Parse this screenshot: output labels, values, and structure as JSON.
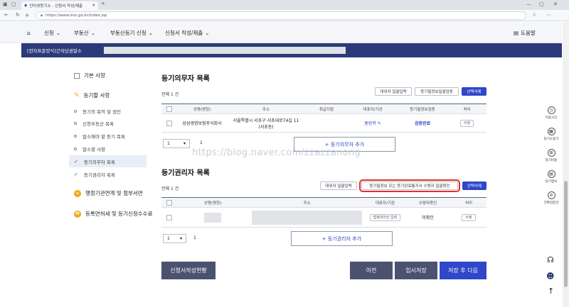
{
  "browser": {
    "tab_title": "인터넷등기소 - 신청서 작성/제출",
    "new_tab": "+",
    "url": "https://www.iros.go.kr/index.jsp"
  },
  "nav": {
    "home_icon": "home-icon",
    "items": [
      "신청",
      "부동산",
      "부동산등기 신청",
      "신청서 작성/제출"
    ],
    "help": "도움말"
  },
  "banner": {
    "label": "[전자표준양식]근저당권말소"
  },
  "left_menu": {
    "basic": "기본 사항",
    "items_title": "등기할 사항",
    "sub": [
      "등기의 목적 및 원인",
      "신청부동산 목록",
      "말소해야 할 등기 목록",
      "말소할 사항",
      "등기의무자 목록",
      "등기권리자 목록"
    ],
    "admin": "행정기관연계 및 첨부서면",
    "fee": "등록면허세 및 등기신청수수료"
  },
  "obligor": {
    "title": "등기의무자 목록",
    "count": "전체 1 건",
    "btn_agent": "대위자 일괄입력",
    "btn_check": "등기필정보일괄검증",
    "btn_delete": "선택삭제",
    "headers": [
      "상명(명칭)",
      "주소",
      "취급지점",
      "대표자/기관",
      "등기필정보검증",
      "처리"
    ],
    "row": {
      "name": "삼성생명보험주식회사",
      "address": "서울특별시 서초구 서초대로74길 11 (서초동)",
      "rep": "홍원학 ✎",
      "verify": "검증완료",
      "action": "수정"
    },
    "page_size": "1",
    "page": "1",
    "add": "+ 등기의무자 추가"
  },
  "obligee": {
    "title": "등기권리자 목록",
    "count": "전체 1 건",
    "btn_agent": "대위자 일괄입력",
    "btn_check": "등기필정보 또는 등기완료통지서 수령자 일괄확인",
    "btn_delete": "선택삭제",
    "headers": [
      "상명(명칭)",
      "주소",
      "대표자/기관",
      "수령자확인",
      "처리"
    ],
    "row": {
      "rep_btn": "법정대리인 입력",
      "receiver": "미확인",
      "action": "수정"
    },
    "page_size": "1",
    "page": "1",
    "add": "+ 등기권리자 추가"
  },
  "watermark": "https://blog.naver.com/zzazzanong",
  "bottom": {
    "status": "신청서작성현황",
    "prev": "이전",
    "save": "임시저장",
    "next": "저장 후 다음"
  },
  "right_tools": [
    "이용시간",
    "등기소찾기",
    "등기비용",
    "등기정보",
    "간편검증안"
  ],
  "colors": {
    "accent": "#2f47c8",
    "banner": "#2c3a79",
    "highlight": "#e0312d"
  }
}
